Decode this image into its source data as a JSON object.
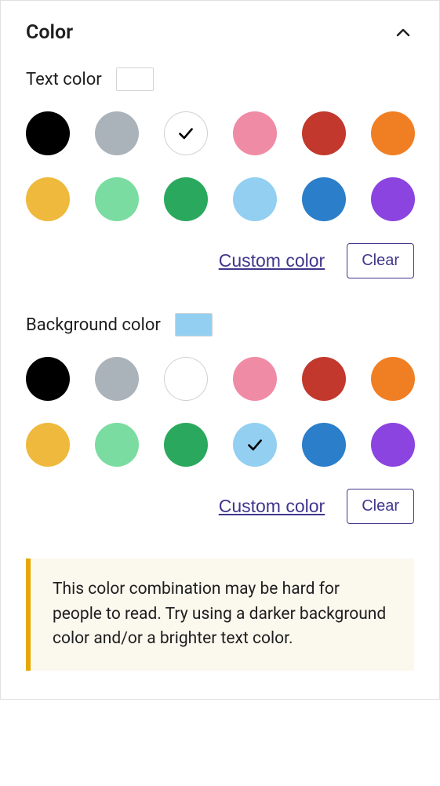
{
  "panel": {
    "title": "Color"
  },
  "text_color": {
    "label": "Text color",
    "current": "#ffffff",
    "selectedIndex": 2,
    "swatches": [
      {
        "name": "black",
        "hex": "#000000",
        "lightBorder": false
      },
      {
        "name": "gray",
        "hex": "#abb3ba",
        "lightBorder": false
      },
      {
        "name": "white",
        "hex": "#ffffff",
        "lightBorder": true
      },
      {
        "name": "pink",
        "hex": "#f08ba6",
        "lightBorder": false
      },
      {
        "name": "red",
        "hex": "#c2382d",
        "lightBorder": false
      },
      {
        "name": "orange",
        "hex": "#f07f24",
        "lightBorder": false
      },
      {
        "name": "amber",
        "hex": "#eeb93c",
        "lightBorder": false
      },
      {
        "name": "mint",
        "hex": "#7adca0",
        "lightBorder": false
      },
      {
        "name": "green",
        "hex": "#2aa95e",
        "lightBorder": false
      },
      {
        "name": "light-blue",
        "hex": "#93cff1",
        "lightBorder": false
      },
      {
        "name": "blue",
        "hex": "#2b7ec9",
        "lightBorder": false
      },
      {
        "name": "purple",
        "hex": "#8b44df",
        "lightBorder": false
      }
    ],
    "custom_label": "Custom color",
    "clear_label": "Clear"
  },
  "background_color": {
    "label": "Background color",
    "current": "#93cff1",
    "selectedIndex": 9,
    "swatches": [
      {
        "name": "black",
        "hex": "#000000",
        "lightBorder": false
      },
      {
        "name": "gray",
        "hex": "#abb3ba",
        "lightBorder": false
      },
      {
        "name": "white",
        "hex": "#ffffff",
        "lightBorder": true
      },
      {
        "name": "pink",
        "hex": "#f08ba6",
        "lightBorder": false
      },
      {
        "name": "red",
        "hex": "#c2382d",
        "lightBorder": false
      },
      {
        "name": "orange",
        "hex": "#f07f24",
        "lightBorder": false
      },
      {
        "name": "amber",
        "hex": "#eeb93c",
        "lightBorder": false
      },
      {
        "name": "mint",
        "hex": "#7adca0",
        "lightBorder": false
      },
      {
        "name": "green",
        "hex": "#2aa95e",
        "lightBorder": false
      },
      {
        "name": "light-blue",
        "hex": "#93cff1",
        "lightBorder": false
      },
      {
        "name": "blue",
        "hex": "#2b7ec9",
        "lightBorder": false
      },
      {
        "name": "purple",
        "hex": "#8b44df",
        "lightBorder": false
      }
    ],
    "custom_label": "Custom color",
    "clear_label": "Clear"
  },
  "notice": {
    "text": "This color combination may be hard for people to read. Try using a darker background color and/or a brighter text color."
  }
}
